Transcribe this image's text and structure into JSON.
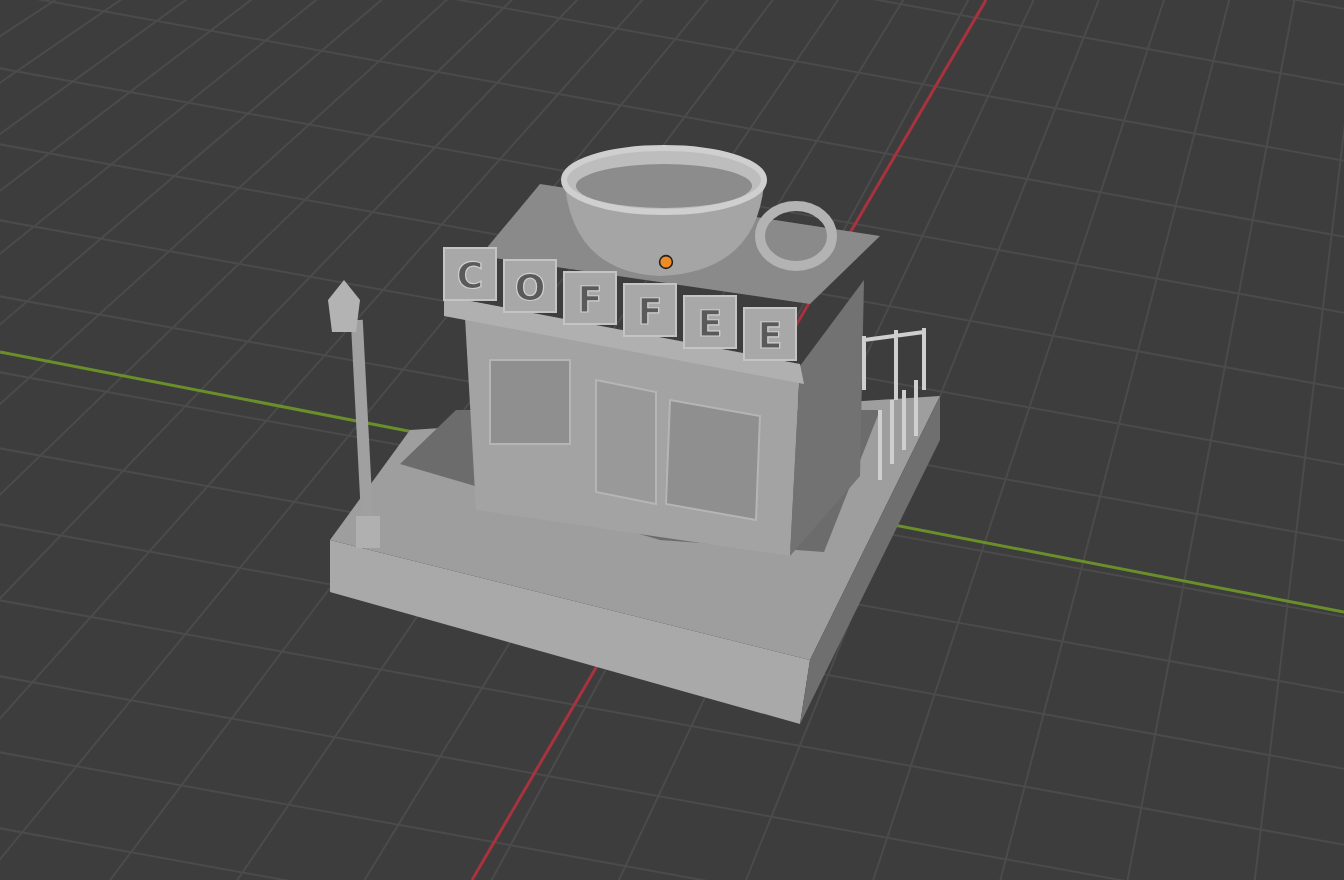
{
  "viewport": {
    "model": {
      "sign_letters": [
        "C",
        "O",
        "F",
        "F",
        "E",
        "E"
      ]
    }
  }
}
